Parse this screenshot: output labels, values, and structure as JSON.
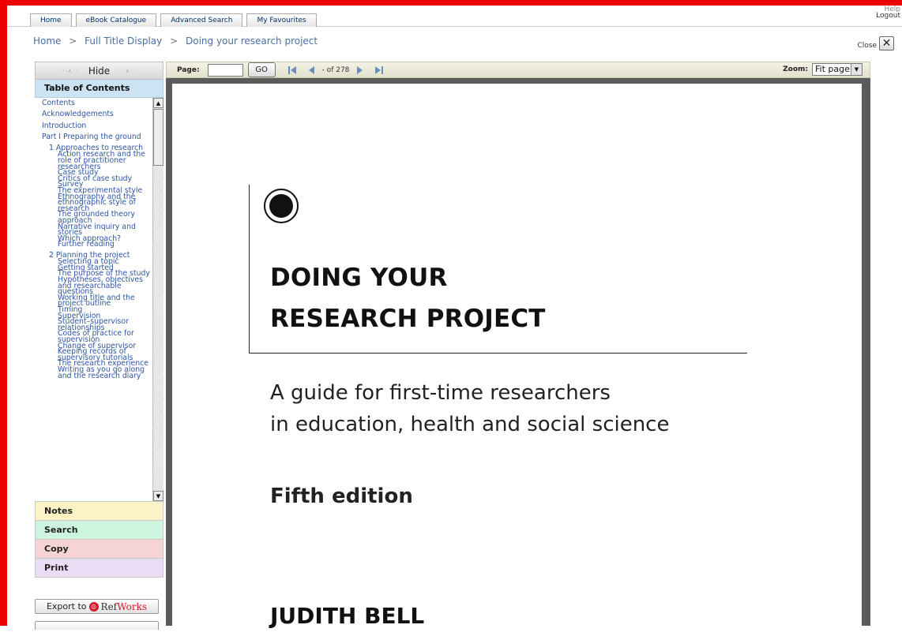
{
  "tabs": [
    "Home",
    "eBook Catalogue",
    "Advanced Search",
    "My Favourites"
  ],
  "top_right": {
    "help": "Help",
    "logout": "Logout"
  },
  "breadcrumb": {
    "home": "Home",
    "sep": ">",
    "full": "Full Title Display",
    "current": "Doing your research project"
  },
  "close_label": "Close",
  "left_panel": {
    "hide_label": "Hide",
    "toc_header": "Table of Contents",
    "toc_items": [
      {
        "text": "Contents",
        "level": 0
      },
      {
        "text": "Acknowledgements",
        "level": 0
      },
      {
        "text": "Introduction",
        "level": 0
      },
      {
        "text": "Part I Preparing the ground",
        "level": 0
      },
      {
        "text": "1 Approaches to research",
        "level": 1
      },
      {
        "text": "Action research and the role of practitioner researchers",
        "level": 2
      },
      {
        "text": "Case study",
        "level": 2
      },
      {
        "text": "Critics of case study",
        "level": 2
      },
      {
        "text": "Survey",
        "level": 2
      },
      {
        "text": "The experimental style",
        "level": 2
      },
      {
        "text": "Ethnography and the ethnographic style of research",
        "level": 2
      },
      {
        "text": "The grounded theory approach",
        "level": 2
      },
      {
        "text": "Narrative inquiry and stories",
        "level": 2
      },
      {
        "text": "Which approach?",
        "level": 2
      },
      {
        "text": "Further reading",
        "level": 2
      },
      {
        "text": "2 Planning the project",
        "level": 1
      },
      {
        "text": "Selecting a topic",
        "level": 2
      },
      {
        "text": "Getting started",
        "level": 2
      },
      {
        "text": "The purpose of the study",
        "level": 2
      },
      {
        "text": "Hypotheses, objectives and researchable questions",
        "level": 2
      },
      {
        "text": "Working title and the project outline",
        "level": 2
      },
      {
        "text": "Timing",
        "level": 2
      },
      {
        "text": "Supervision",
        "level": 2
      },
      {
        "text": "Student–supervisor relationships",
        "level": 2
      },
      {
        "text": "Codes of practice for supervision",
        "level": 2
      },
      {
        "text": "Change of supervisor",
        "level": 2
      },
      {
        "text": "Keeping records of supervisory tutorials",
        "level": 2
      },
      {
        "text": "The research experience",
        "level": 2
      },
      {
        "text": "Writing as you go along and the research diary",
        "level": 2
      }
    ],
    "notes": "Notes",
    "search": "Search",
    "copy": "Copy",
    "print": "Print",
    "export_label": "Export to",
    "refworks_ref": "Ref",
    "refworks_works": "Works"
  },
  "toolbar": {
    "page_label": "Page:",
    "page_value": "",
    "go": "GO",
    "of_label": "- of 278",
    "zoom_label": "Zoom:",
    "zoom_value": "Fit page"
  },
  "document": {
    "title_line1": "DOING YOUR",
    "title_line2": "RESEARCH PROJECT",
    "subtitle_line1": "A guide for first-time researchers",
    "subtitle_line2": "in education, health and social science",
    "edition": "Fifth edition",
    "author": "JUDITH BELL"
  }
}
